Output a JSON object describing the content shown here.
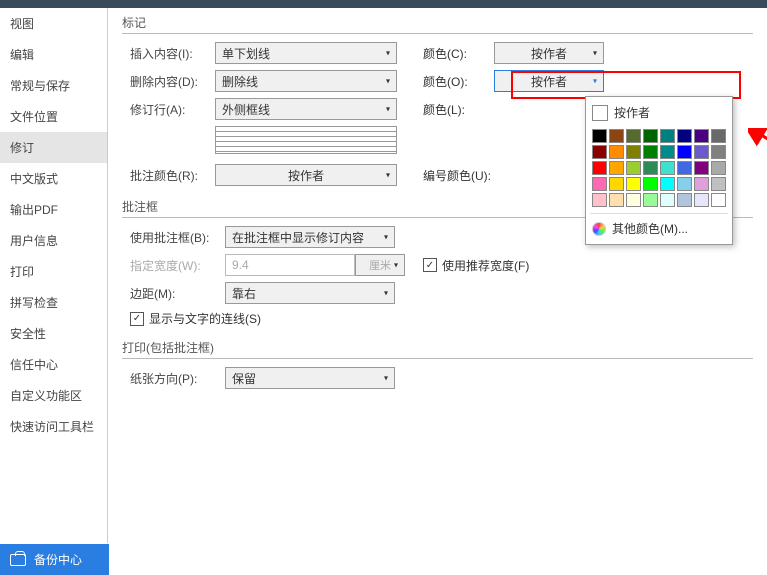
{
  "sidebar": {
    "items": [
      {
        "label": "视图"
      },
      {
        "label": "编辑"
      },
      {
        "label": "常规与保存"
      },
      {
        "label": "文件位置"
      },
      {
        "label": "修订"
      },
      {
        "label": "中文版式"
      },
      {
        "label": "输出PDF"
      },
      {
        "label": "用户信息"
      },
      {
        "label": "打印"
      },
      {
        "label": "拼写检查"
      },
      {
        "label": "安全性"
      },
      {
        "label": "信任中心"
      },
      {
        "label": "自定义功能区"
      },
      {
        "label": "快速访问工具栏"
      }
    ],
    "selected": "修订"
  },
  "sections": {
    "mark": "标记",
    "balloon": "批注框",
    "print": "打印(包括批注框)"
  },
  "mark": {
    "insert_label": "插入内容(I):",
    "insert_value": "单下划线",
    "insert_color_label": "颜色(C):",
    "insert_color_value": "按作者",
    "delete_label": "删除内容(D):",
    "delete_value": "删除线",
    "delete_color_label": "颜色(O):",
    "delete_color_value": "按作者",
    "revise_label": "修订行(A):",
    "revise_value": "外侧框线",
    "revise_color_label": "颜色(L):",
    "comment_color_label": "批注颜色(R):",
    "comment_color_value": "按作者",
    "number_color_label": "编号颜色(U):"
  },
  "balloon": {
    "use_label": "使用批注框(B):",
    "use_value": "在批注框中显示修订内容",
    "width_label": "指定宽度(W):",
    "width_value": "9.4",
    "width_unit": "厘米",
    "recommend_label": "使用推荐宽度(F)",
    "margin_label": "边距(M):",
    "margin_value": "靠右",
    "show_lines_label": "显示与文字的连线(S)"
  },
  "print_section": {
    "paper_label": "纸张方向(P):",
    "paper_value": "保留"
  },
  "color_popup": {
    "by_author": "按作者",
    "other_colors": "其他颜色(M)...",
    "swatches": [
      "#000000",
      "#8b4513",
      "#556b2f",
      "#006400",
      "#008080",
      "#000080",
      "#4b0082",
      "#696969",
      "#8b0000",
      "#ff8c00",
      "#808000",
      "#008000",
      "#008b8b",
      "#0000ff",
      "#6a5acd",
      "#808080",
      "#ff0000",
      "#ffa500",
      "#9acd32",
      "#2e8b57",
      "#40e0d0",
      "#4169e1",
      "#800080",
      "#a9a9a9",
      "#ff69b4",
      "#ffd700",
      "#ffff00",
      "#00ff00",
      "#00ffff",
      "#87ceeb",
      "#dda0dd",
      "#c0c0c0",
      "#ffc0cb",
      "#ffdead",
      "#ffffe0",
      "#98fb98",
      "#e0ffff",
      "#b0c4de",
      "#e6e6fa",
      "#ffffff"
    ]
  },
  "bottom": {
    "backup": "备份中心"
  },
  "caret": "▾",
  "check": "✓"
}
